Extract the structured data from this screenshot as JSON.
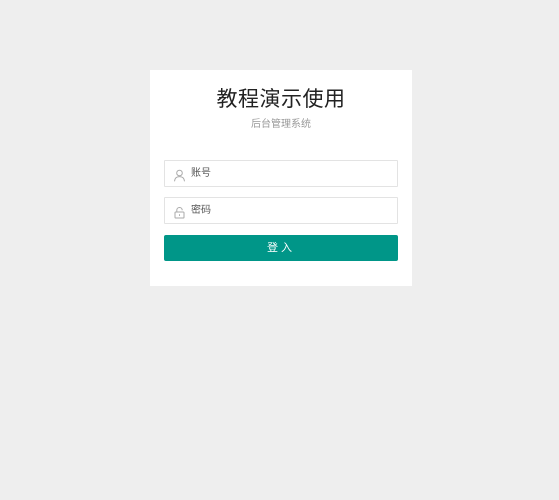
{
  "login": {
    "title": "教程演示使用",
    "subtitle": "后台管理系统",
    "username": {
      "placeholder": "账号",
      "value": "",
      "icon": "user-icon"
    },
    "password": {
      "placeholder": "密码",
      "value": "",
      "icon": "lock-icon"
    },
    "submit_label": "登入"
  },
  "colors": {
    "background": "#eeeeee",
    "card": "#ffffff",
    "accent": "#009688"
  }
}
